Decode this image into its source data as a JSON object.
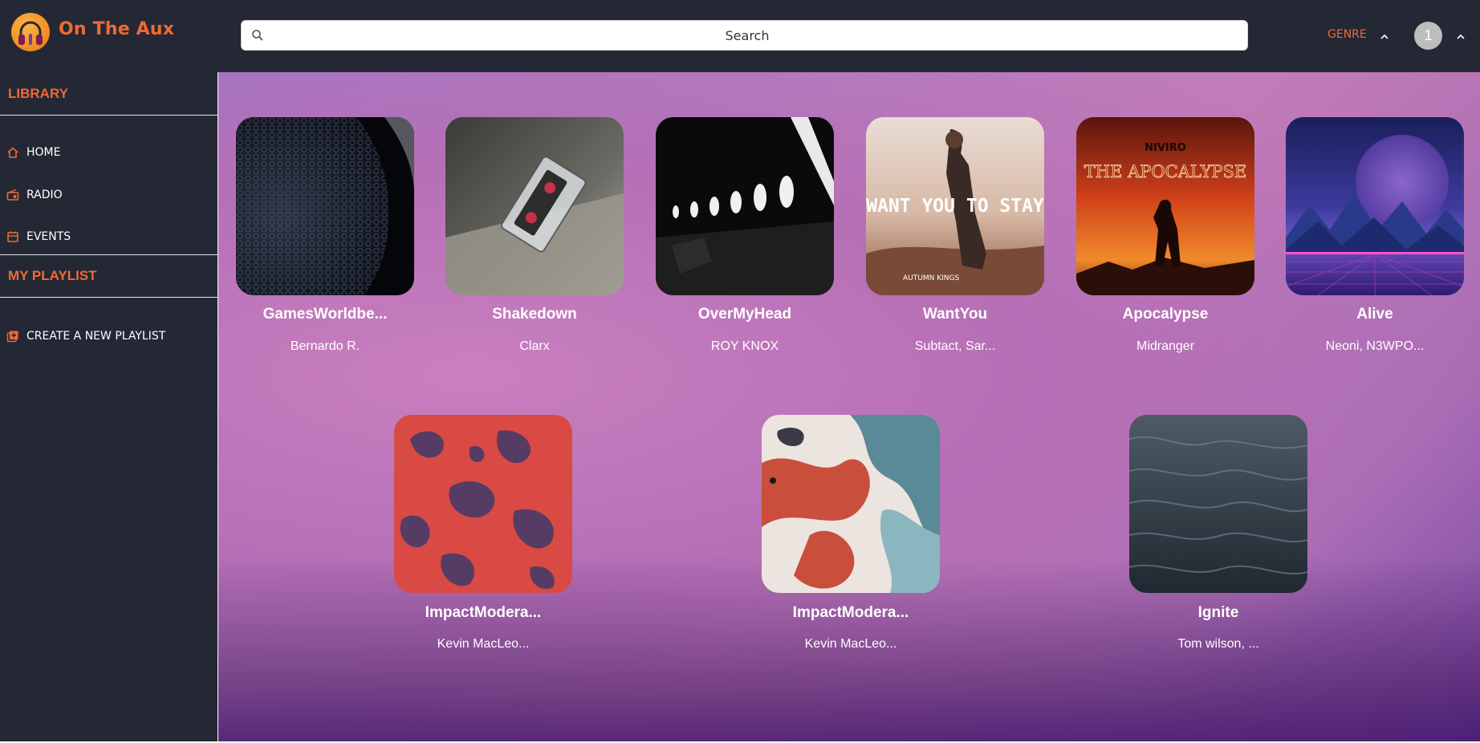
{
  "app": {
    "name": "On The Aux"
  },
  "search": {
    "placeholder": "Search"
  },
  "header": {
    "genre_label": "GENRE",
    "avatar_initial": "1"
  },
  "sidebar": {
    "library_title": "LIBRARY",
    "items": [
      {
        "label": "HOME",
        "icon": "home-icon"
      },
      {
        "label": "RADIO",
        "icon": "radio-icon"
      },
      {
        "label": "EVENTS",
        "icon": "calendar-icon"
      }
    ],
    "playlist_title": "MY PLAYLIST",
    "create_playlist_label": "CREATE A NEW PLAYLIST"
  },
  "albums": [
    {
      "title": "GamesWorldbe...",
      "artist": "Bernardo R."
    },
    {
      "title": "Shakedown",
      "artist": "Clarx"
    },
    {
      "title": "OverMyHead",
      "artist": "ROY KNOX"
    },
    {
      "title": "WantYou",
      "artist": "Subtact, Sar...",
      "art_text": "WANT YOU TO STAY",
      "art_subtext": "AUTUMN KINGS"
    },
    {
      "title": "Apocalypse",
      "artist": "Midranger",
      "art_text": "THE APOCALYPSE",
      "art_subtext": "NIVIRO"
    },
    {
      "title": "Alive",
      "artist": "Neoni, N3WPO..."
    },
    {
      "title": "ImpactModera...",
      "artist": "Kevin MacLeo..."
    },
    {
      "title": "ImpactModera...",
      "artist": "Kevin MacLeo..."
    },
    {
      "title": "Ignite",
      "artist": "Tom wilson, ..."
    }
  ],
  "colors": {
    "accent": "#ee6a33",
    "panel": "#242834"
  }
}
